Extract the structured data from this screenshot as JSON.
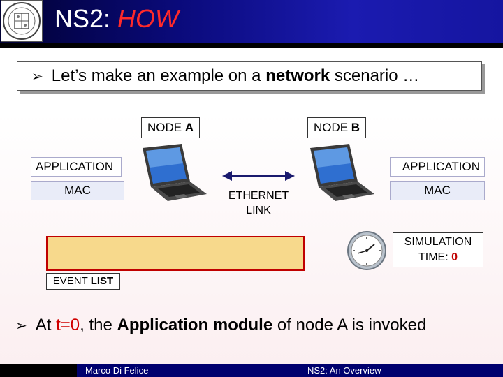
{
  "header": {
    "title_prefix": "NS2: ",
    "title_highlight": "HOW"
  },
  "intro": {
    "text_before": "Let’s make an example on a ",
    "text_bold": "network",
    "text_after": " scenario …"
  },
  "nodes": {
    "a": {
      "prefix": "NODE ",
      "name": "A",
      "app": "APPLICATION",
      "mac": "MAC"
    },
    "b": {
      "prefix": "NODE ",
      "name": "B",
      "app": "APPLICATION",
      "mac": "MAC"
    }
  },
  "link": {
    "line1": "ETHERNET",
    "line2": "LINK"
  },
  "event_list": {
    "prefix": "EVENT ",
    "bold": "LIST"
  },
  "simulation": {
    "line1": "SIMULATION",
    "line2_prefix": "TIME: ",
    "value": "0"
  },
  "bottom": {
    "p1": "At ",
    "p2": "t=0",
    "p3": ", the ",
    "p4": "Application module",
    "p5": " of node A is invoked"
  },
  "footer": {
    "author": "Marco Di Felice",
    "title": "NS2: An Overview"
  },
  "colors": {
    "header_blue": "#0a0a7a",
    "accent_red": "#d00000",
    "event_fill": "#f7d98c",
    "footer_blue": "#00006e"
  }
}
